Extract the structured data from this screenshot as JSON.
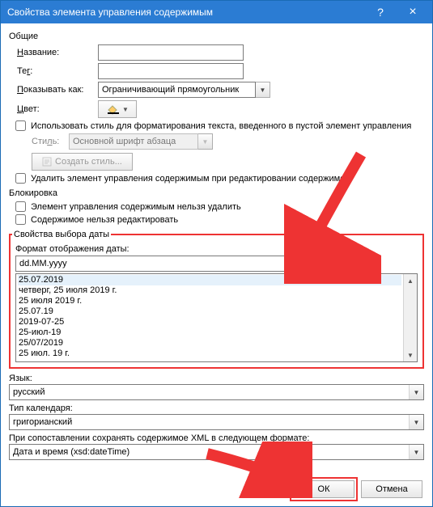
{
  "title": "Свойства элемента управления содержимым",
  "general": {
    "section": "Общие",
    "name_label": "Название:",
    "name_value": "",
    "tag_label": "Тег:",
    "tag_value": "",
    "showas_label": "Показывать как:",
    "showas_value": "Ограничивающий прямоугольник",
    "color_label": "Цвет:",
    "style_checkbox": "Использовать стиль для форматирования текста, введенного в пустой элемент управления",
    "style_label": "Стиль:",
    "style_value": "Основной шрифт абзаца",
    "new_style_btn": "Создать стиль...",
    "remove_checkbox": "Удалить элемент управления содержимым при редактировании содержимого"
  },
  "locking": {
    "section": "Блокировка",
    "no_delete": "Элемент управления содержимым нельзя удалить",
    "no_edit": "Содержимое нельзя редактировать"
  },
  "date": {
    "section": "Свойства выбора даты",
    "format_label": "Формат отображения даты:",
    "format_value": "dd.MM.yyyy",
    "list": [
      "25.07.2019",
      "четверг, 25 июля 2019 г.",
      "25 июля 2019 г.",
      "25.07.19",
      "2019-07-25",
      "25-июл-19",
      "25/07/2019",
      "25 июл. 19 г."
    ]
  },
  "locale": {
    "lang_label": "Язык:",
    "lang_value": "русский",
    "cal_label": "Тип календаря:",
    "cal_value": "григорианский",
    "xml_label": "При сопоставлении сохранять содержимое XML в следующем формате:",
    "xml_value": "Дата и время (xsd:dateTime)"
  },
  "buttons": {
    "ok": "ОК",
    "cancel": "Отмена"
  }
}
